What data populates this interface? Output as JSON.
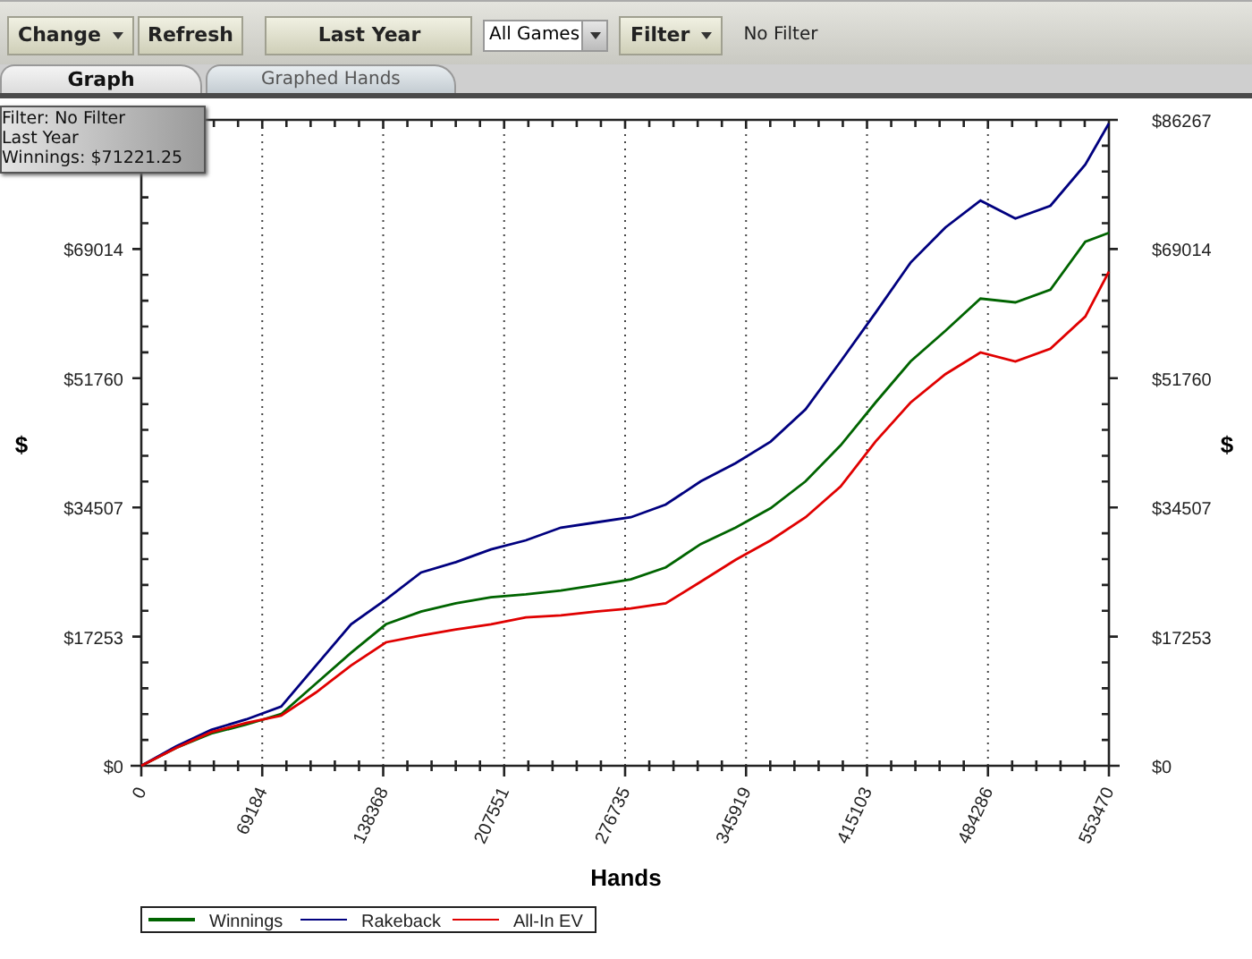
{
  "toolbar": {
    "buttons": [
      {
        "label": "Change",
        "kind": "menu"
      },
      {
        "label": "Refresh",
        "kind": "plain"
      },
      {
        "label": "Last Year",
        "kind": "wide"
      }
    ],
    "game_select": {
      "value": "All Games"
    },
    "filter_button": {
      "label": "Filter"
    },
    "filter_status": "No Filter"
  },
  "tabs": [
    {
      "label": "Graph",
      "selected": true
    },
    {
      "label": "Graphed Hands",
      "selected": false
    }
  ],
  "tooltip": {
    "lines": [
      "Filter: No Filter",
      "Last Year",
      "Winnings: $71221.25"
    ]
  },
  "chart": {
    "ylabel_right": "$",
    "right_ytick_labels": [
      "$86267",
      "$69014",
      "$51760",
      "$34507",
      "$17253",
      "$0"
    ],
    "chart_data": {
      "type": "line",
      "xlabel": "Hands",
      "ylabel": "$",
      "x": [
        0,
        20000,
        40000,
        60000,
        80000,
        100000,
        120000,
        140000,
        160000,
        180000,
        200000,
        220000,
        240000,
        260000,
        280000,
        300000,
        320000,
        340000,
        360000,
        380000,
        400000,
        420000,
        440000,
        460000,
        480000,
        500000,
        520000,
        540000,
        553470
      ],
      "series": [
        {
          "name": "Winnings",
          "color": "#006400",
          "values": [
            0,
            2400,
            4300,
            5500,
            6900,
            11000,
            15100,
            18900,
            20600,
            21700,
            22500,
            22900,
            23400,
            24100,
            24900,
            26500,
            29600,
            31800,
            34400,
            38000,
            42800,
            48500,
            54000,
            58100,
            62400,
            61900,
            63600,
            70000,
            71200
          ]
        },
        {
          "name": "Rakeback",
          "color": "#00007f",
          "values": [
            0,
            2600,
            4800,
            6200,
            7900,
            13400,
            18900,
            22200,
            25800,
            27200,
            28900,
            30100,
            31800,
            32500,
            33200,
            34900,
            38000,
            40400,
            43300,
            47600,
            54000,
            60500,
            67200,
            71900,
            75500,
            73100,
            74800,
            80300,
            85800
          ]
        },
        {
          "name": "All-In EV",
          "color": "#e00000",
          "values": [
            0,
            2400,
            4500,
            5700,
            6700,
            9800,
            13400,
            16500,
            17400,
            18200,
            18900,
            19800,
            20100,
            20600,
            21000,
            21700,
            24600,
            27500,
            30100,
            33200,
            37300,
            43300,
            48500,
            52300,
            55200,
            54000,
            55700,
            60000,
            66000
          ]
        }
      ],
      "grid": {
        "x": true,
        "y": false
      },
      "legend": true,
      "xlim": [
        0,
        553470
      ],
      "ylim": [
        0,
        86267
      ],
      "xticks": [
        0,
        69184,
        138368,
        207551,
        276735,
        345919,
        415103,
        484286,
        553470
      ],
      "yticks": [
        {
          "value": 0,
          "label": "$0"
        },
        {
          "value": 17253,
          "label": "$17253"
        },
        {
          "value": 34507,
          "label": "$34507"
        },
        {
          "value": 51760,
          "label": "$51760"
        },
        {
          "value": 69014,
          "label": "$69014"
        }
      ]
    }
  }
}
